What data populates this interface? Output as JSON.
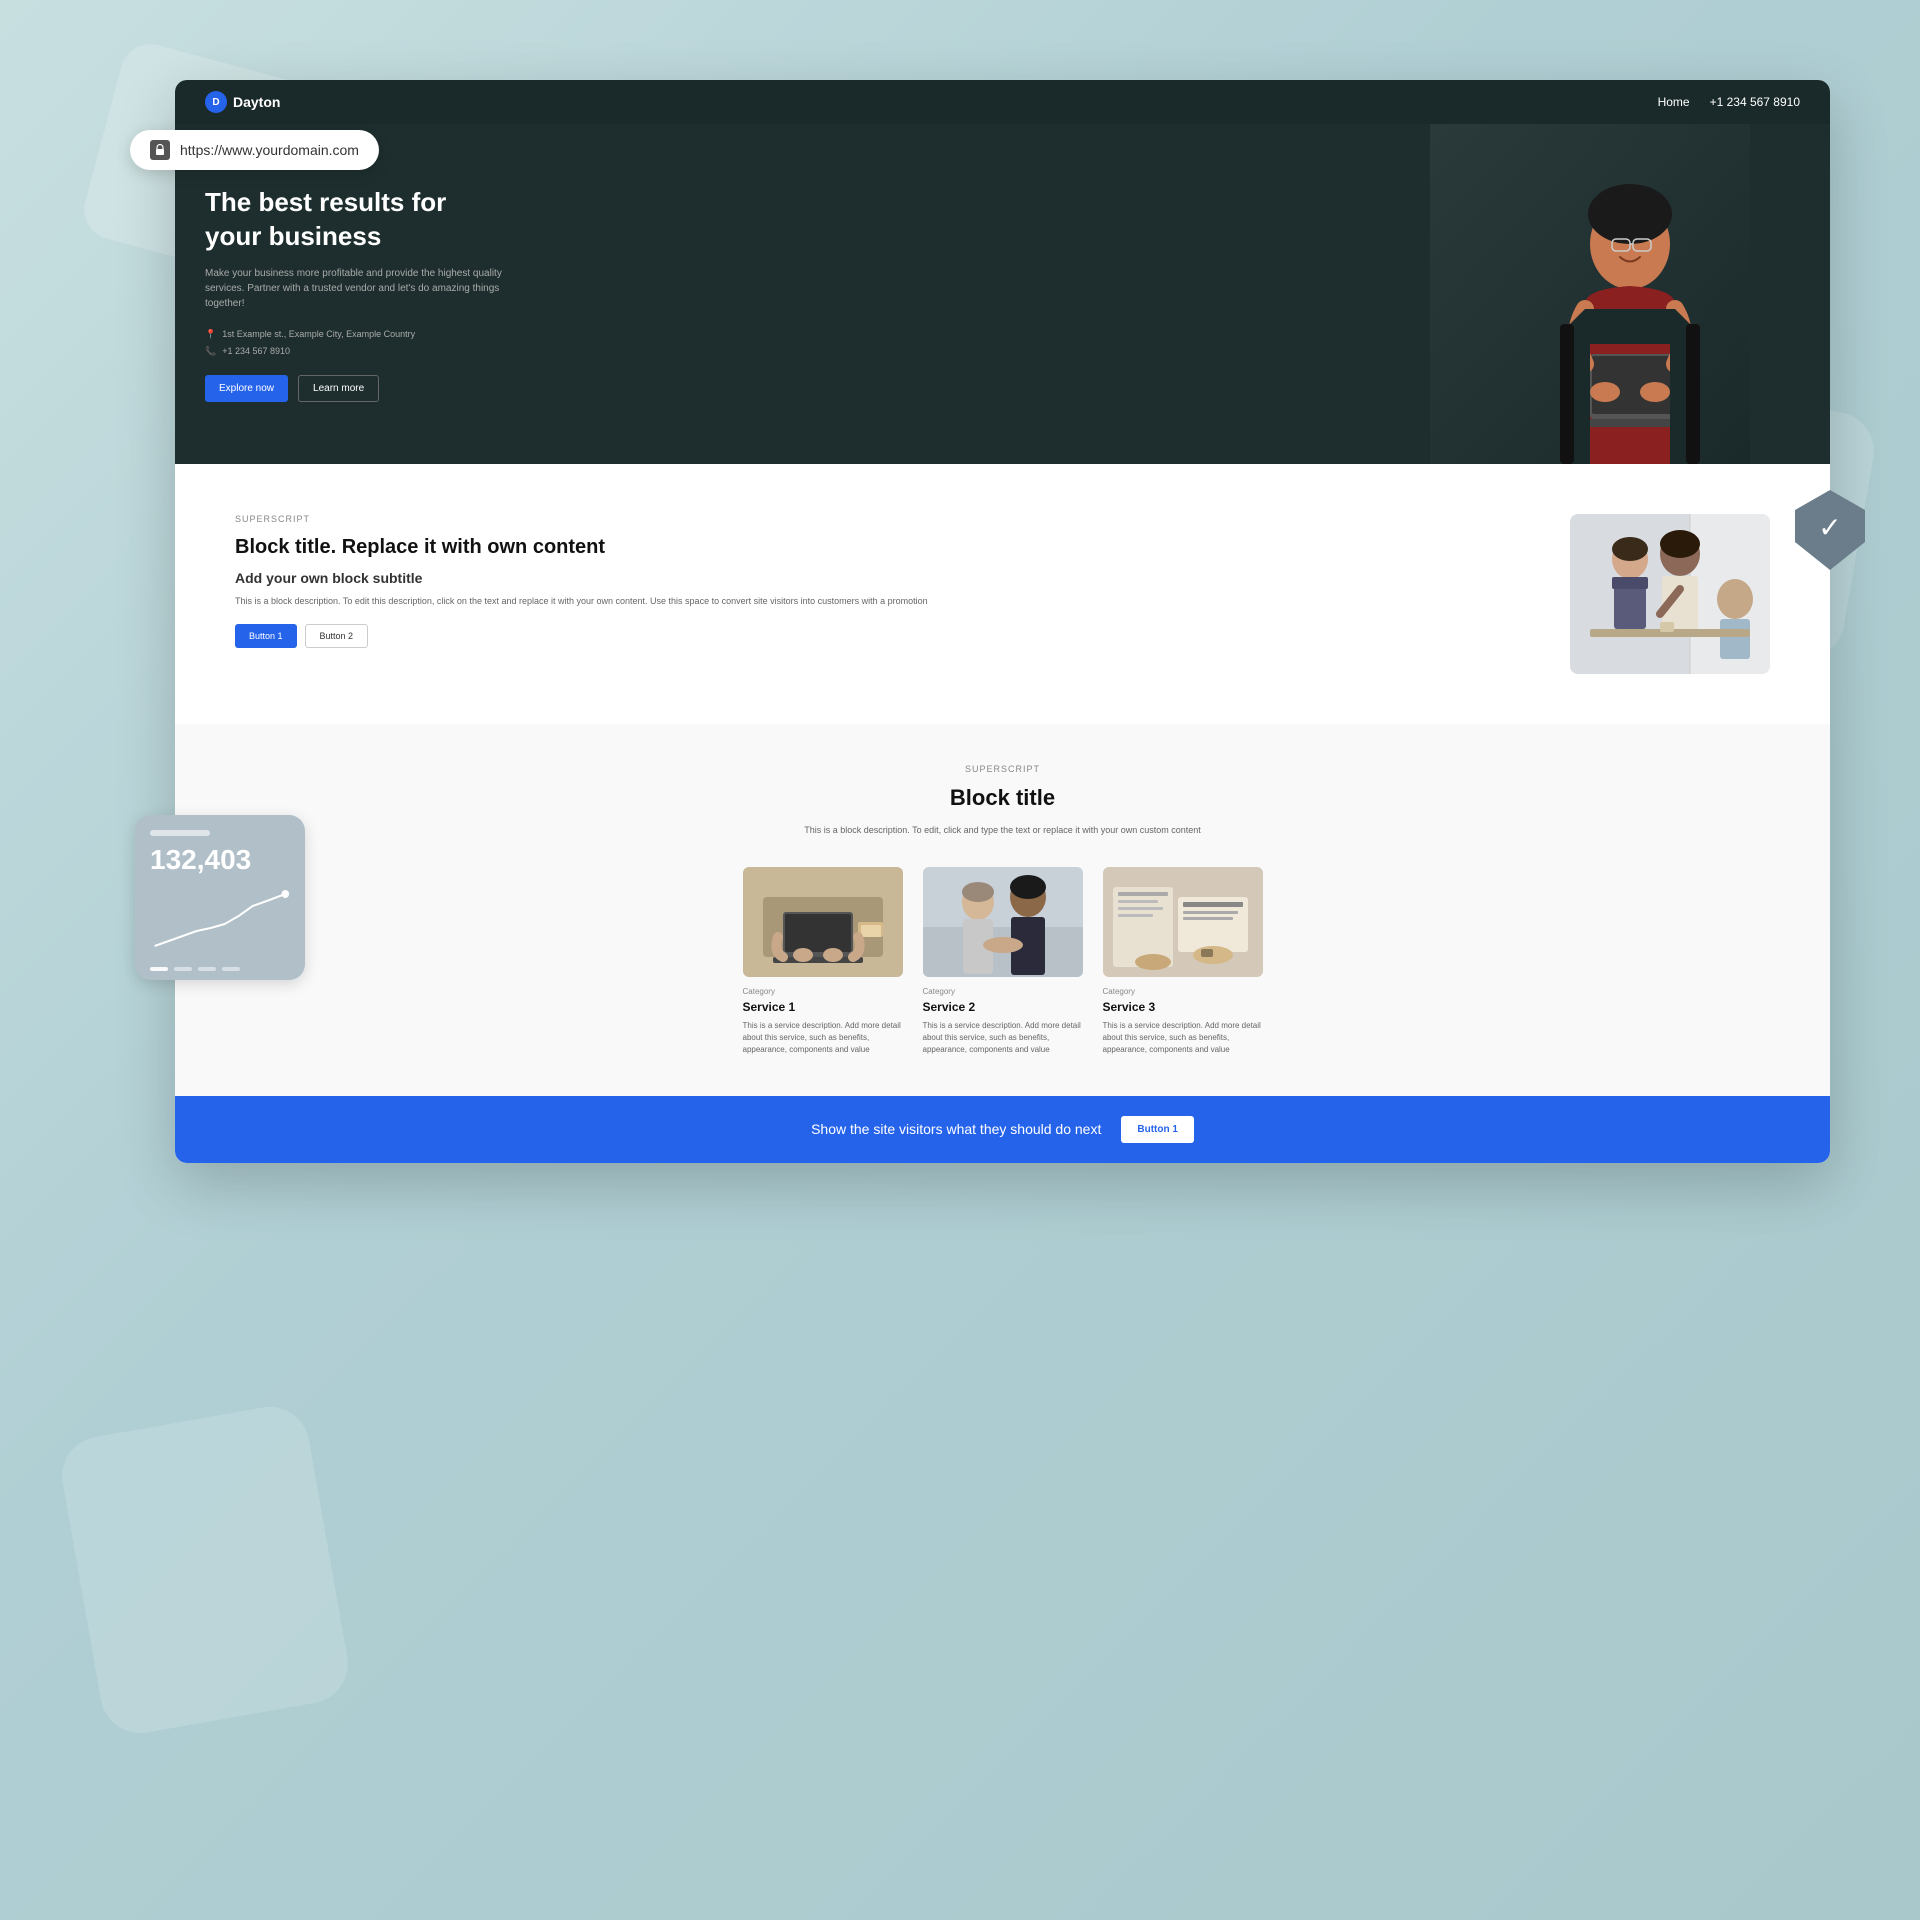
{
  "browser": {
    "url": "https://www.yourdomain.com",
    "lock_icon": "🔒"
  },
  "nav": {
    "logo_text": "Dayton",
    "logo_letter": "D",
    "home_label": "Home",
    "phone": "+1 234 567 8910"
  },
  "hero": {
    "title": "The best results for your business",
    "subtitle": "Make your business more profitable and provide the highest quality services. Partner with a trusted vendor and let's do amazing things together!",
    "address": "1st Example st., Example City, Example Country",
    "phone": "+1 234 567 8910",
    "explore_btn": "Explore now",
    "learn_btn": "Learn more"
  },
  "block1": {
    "superscript": "SUPERSCRIPT",
    "title": "Block title. Replace it with own content",
    "subtitle": "Add your own block subtitle",
    "description": "This is a block description. To edit this description, click on the text and replace it with your own content. Use this space to convert site visitors into customers with a promotion",
    "btn1": "Button 1",
    "btn2": "Button 2"
  },
  "block2": {
    "superscript": "SUPERSCRIPT",
    "title": "Block title",
    "description": "This is a block description. To edit, click and type the text or replace it with your own custom content",
    "services": [
      {
        "category": "Category",
        "title": "Service 1",
        "description": "This is a service description. Add more detail about this service, such as benefits, appearance, components and value"
      },
      {
        "category": "Category",
        "title": "Service 2",
        "description": "This is a service description. Add more detail about this service, such as benefits, appearance, components and value"
      },
      {
        "category": "Category",
        "title": "Service 3",
        "description": "This is a service description. Add more detail about this service, such as benefits, appearance, components and value"
      }
    ]
  },
  "cta": {
    "text": "Show the site visitors what they should do next",
    "button": "Button 1"
  },
  "stats": {
    "number": "132,403"
  }
}
